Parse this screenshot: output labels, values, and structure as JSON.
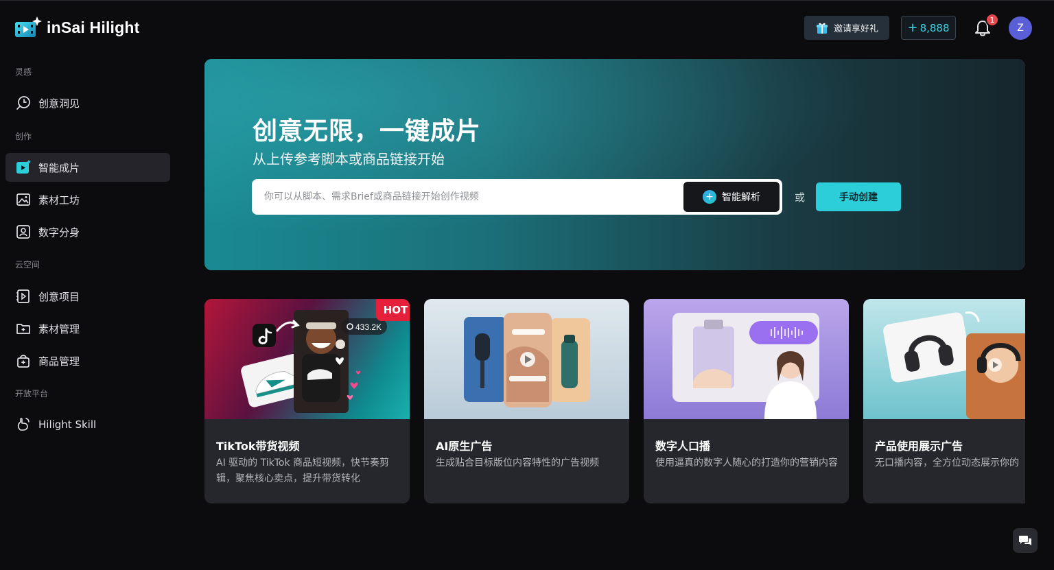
{
  "app": {
    "name": "inSai Hilight"
  },
  "header": {
    "invite_label": "邀请享好礼",
    "credits_prefix": "+",
    "credits_value": "8,888",
    "notification_count": "1",
    "avatar_initial": "Z",
    "colors": {
      "accent": "#2ccfd9",
      "badge": "#e5484d",
      "avatar": "#5a5fd8"
    }
  },
  "sidebar": {
    "sections": [
      {
        "title": "灵感",
        "items": [
          {
            "label": "创意洞见",
            "icon": "insight-bulb-icon"
          }
        ]
      },
      {
        "title": "创作",
        "items": [
          {
            "label": "智能成片",
            "icon": "smart-video-icon",
            "active": true
          },
          {
            "label": "素材工坊",
            "icon": "material-image-icon"
          },
          {
            "label": "数字分身",
            "icon": "digital-avatar-icon"
          }
        ]
      },
      {
        "title": "云空间",
        "items": [
          {
            "label": "创意项目",
            "icon": "project-film-icon"
          },
          {
            "label": "素材管理",
            "icon": "folder-add-icon"
          },
          {
            "label": "商品管理",
            "icon": "bag-add-icon"
          }
        ]
      },
      {
        "title": "开放平台",
        "items": [
          {
            "label": "Hilight Skill",
            "icon": "hand-skill-icon"
          }
        ]
      }
    ]
  },
  "hero": {
    "title": "创意无限，一键成片",
    "subtitle": "从上传参考脚本或商品链接开始",
    "input_placeholder": "你可以从脚本、需求Brief或商品链接开始创作视频",
    "input_value": "",
    "analyze_label": "智能解析",
    "or_label": "或",
    "manual_label": "手动创建"
  },
  "cards": [
    {
      "title": "TikTok带货视频",
      "desc": "AI 驱动的 TikTok 商品短视频，快节奏剪辑，聚焦核心卖点，提升带货转化",
      "badge": "HOT",
      "views": "433.2K"
    },
    {
      "title": "AI原生广告",
      "desc": "生成贴合目标版位内容特性的广告视频"
    },
    {
      "title": "数字人口播",
      "desc": "使用逼真的数字人随心的打造你的营销内容"
    },
    {
      "title": "产品使用展示广告",
      "desc": "无口播内容，全方位动态展示你的"
    }
  ]
}
